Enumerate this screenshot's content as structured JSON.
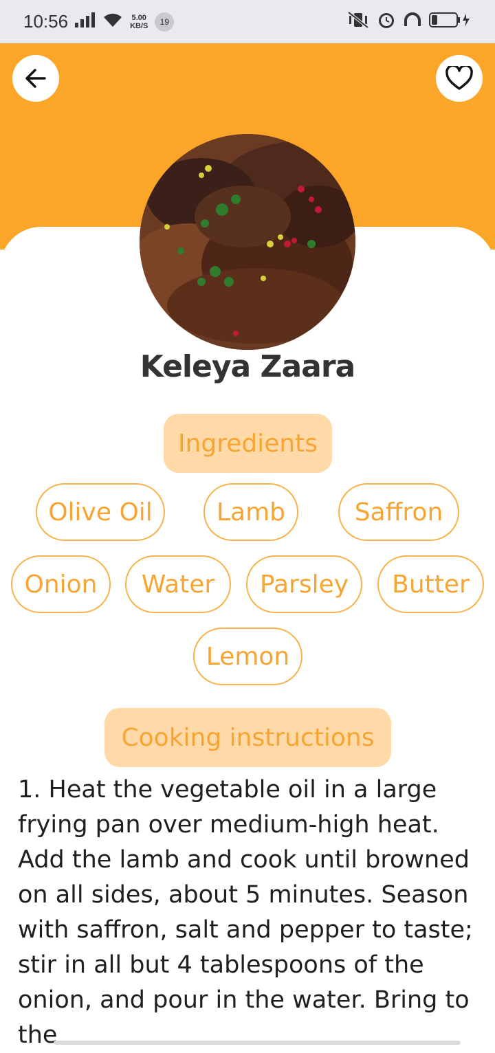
{
  "status_bar": {
    "time": "10:56",
    "net_speed_value": "5.00",
    "net_speed_unit": "KB/S",
    "notification_count": "19"
  },
  "header": {
    "back_icon": "arrow-left-icon",
    "favorite_icon": "heart-outline-icon",
    "accent_color": "#fba629"
  },
  "recipe": {
    "title": "Keleya Zaara",
    "ingredients_label": "Ingredients",
    "ingredients": [
      "Olive Oil",
      "Lamb",
      "Saffron",
      "Onion",
      "Water",
      "Parsley",
      "Butter",
      "Lemon"
    ],
    "instructions_label": "Cooking instructions",
    "instructions_text": "1.  Heat the vegetable oil in a large frying pan over medium-high heat. Add the lamb and cook until browned on all sides,  about 5 minutes.  Season with saffron,  salt and pepper to taste;  stir in all but 4 tablespoons of the onion,  and pour in the water.  Bring to the"
  }
}
